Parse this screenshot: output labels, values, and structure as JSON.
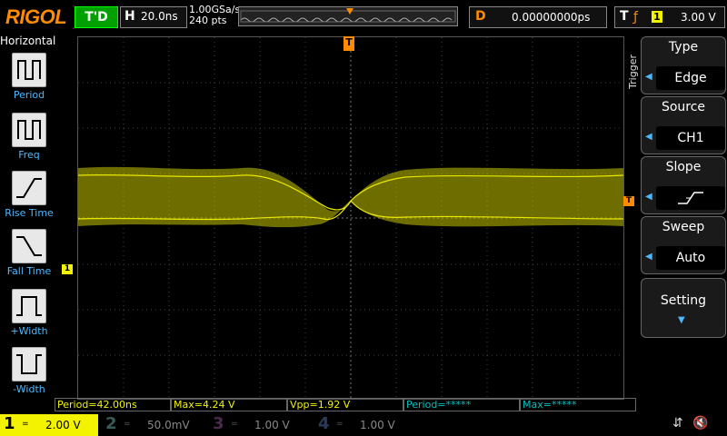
{
  "header": {
    "brand": "RIGOL",
    "run_state": "T'D",
    "horizontal_key": "H",
    "timebase": "20.0ns",
    "sample_rate": "1.00GSa/s",
    "points": "240 pts",
    "delay_key": "D",
    "delay": "0.00000000ps",
    "trigger_key": "T",
    "trigger_source_num": "1",
    "trigger_level": "3.00 V"
  },
  "left_panel": {
    "title": "Horizontal",
    "items": [
      {
        "label": "Period"
      },
      {
        "label": "Freq"
      },
      {
        "label": "Rise Time"
      },
      {
        "label": "Fall Time"
      },
      {
        "label": "+Width"
      },
      {
        "label": "-Width"
      }
    ]
  },
  "right_panel": {
    "section": "Trigger",
    "buttons": [
      {
        "title": "Type",
        "value": "Edge"
      },
      {
        "title": "Source",
        "value": "CH1"
      },
      {
        "title": "Slope",
        "value": ""
      },
      {
        "title": "Sweep",
        "value": "Auto"
      },
      {
        "title": "Setting",
        "value": ""
      }
    ]
  },
  "measurements": [
    {
      "text": "Period=42.00ns"
    },
    {
      "text": "Max=4.24 V"
    },
    {
      "text": "Vpp=1.92 V"
    },
    {
      "text": "Period=*****"
    },
    {
      "text": "Max=*****"
    }
  ],
  "channels": [
    {
      "num": "1",
      "coupling": "=",
      "scale": "2.00 V",
      "color": "#f3f300"
    },
    {
      "num": "2",
      "coupling": "=",
      "scale": "50.0mV",
      "color": "#00c0c0"
    },
    {
      "num": "3",
      "coupling": "=",
      "scale": "1.00 V",
      "color": "#ff00ff"
    },
    {
      "num": "4",
      "coupling": "=",
      "scale": "1.00 V",
      "color": "#3d6cff"
    }
  ],
  "markers": {
    "ch1_level": "1",
    "trig_pos": "T"
  },
  "colors": {
    "accent": "#ff8c00",
    "trace": "#f3f300",
    "link": "#4db8ff"
  }
}
